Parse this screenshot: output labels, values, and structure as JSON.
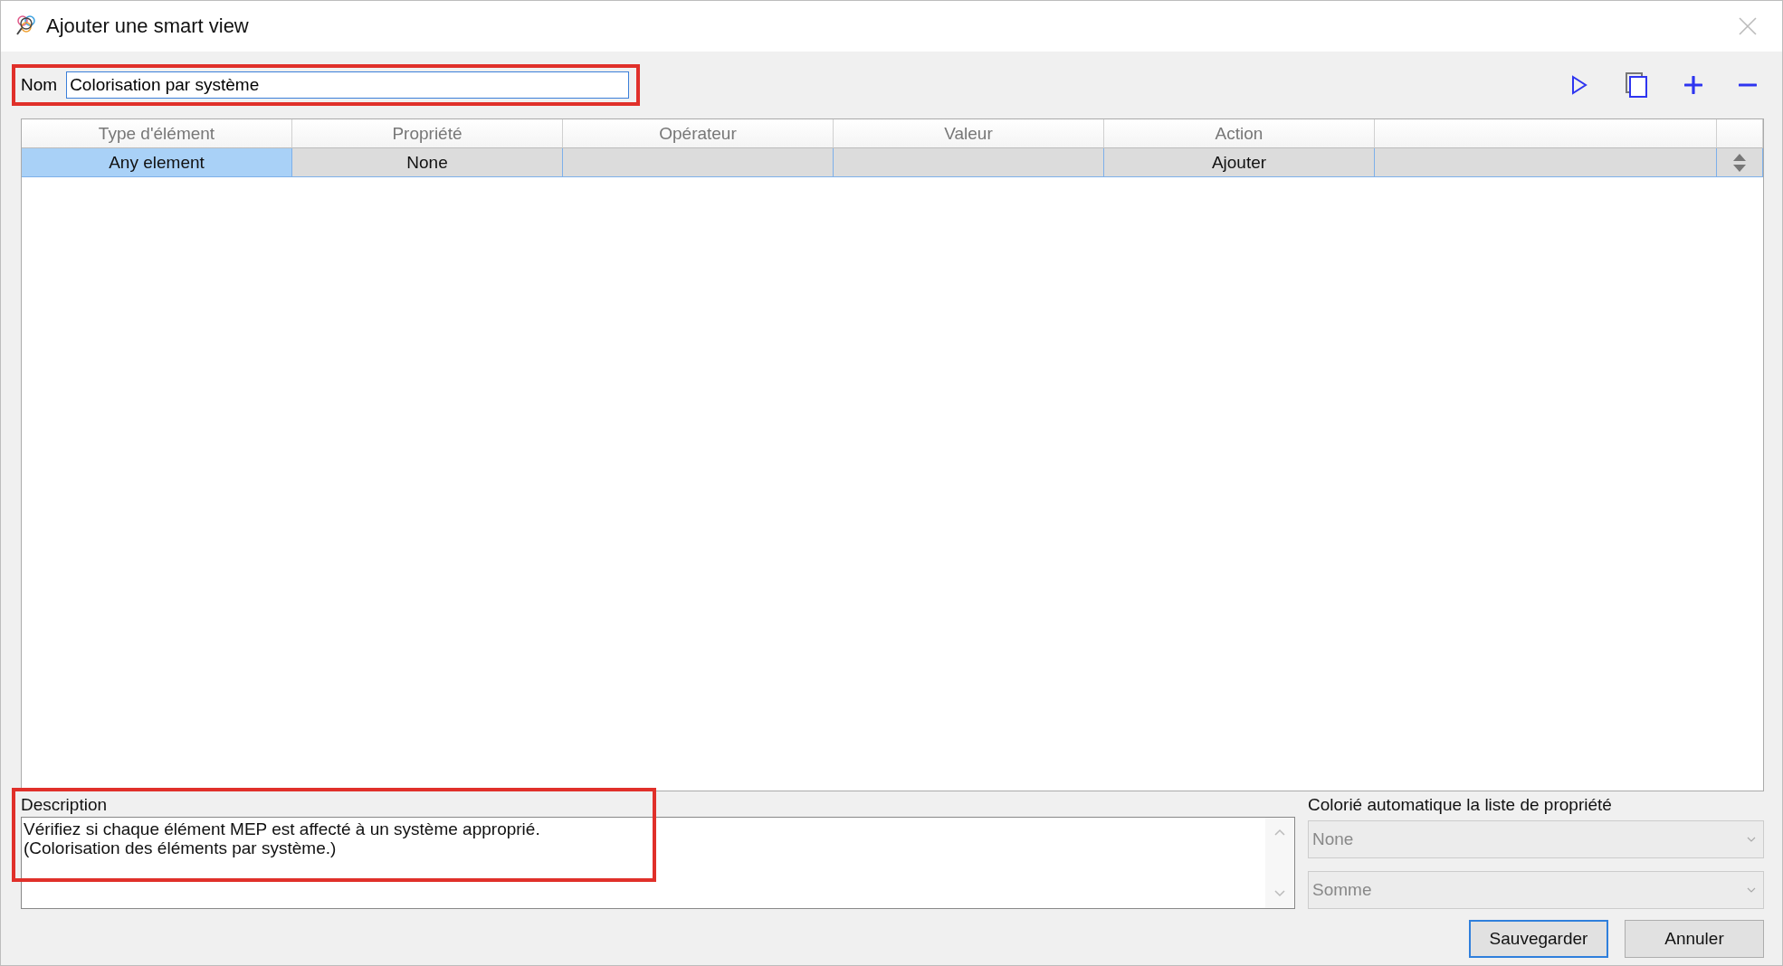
{
  "window": {
    "title": "Ajouter une smart view"
  },
  "name_field": {
    "label": "Nom",
    "value": "Colorisation par système",
    "highlighted": true
  },
  "table": {
    "columns": [
      "Type d'élément",
      "Propriété",
      "Opérateur",
      "Valeur",
      "Action"
    ],
    "rows": [
      {
        "cells": [
          {
            "text": "Any element",
            "selected": true
          },
          {
            "text": "None",
            "selected": false
          },
          {
            "selected": false
          },
          {
            "selected": false
          },
          {
            "text": "Ajouter",
            "selected": false
          },
          {
            "selected": false
          }
        ]
      }
    ]
  },
  "description": {
    "label": "Description",
    "text": "Vérifiez si chaque élément MEP est affecté à un système approprié.\n(Colorisation des éléments par système.)",
    "highlighted": true
  },
  "auto_color": {
    "label": "Colorié automatique la liste de propriété",
    "dropdowns": [
      {
        "value": "None",
        "disabled": true
      },
      {
        "value": "Somme",
        "disabled": true
      }
    ]
  },
  "buttons": [
    {
      "label": "Sauvegarder",
      "default": true
    },
    {
      "label": "Annuler",
      "default": false
    }
  ]
}
